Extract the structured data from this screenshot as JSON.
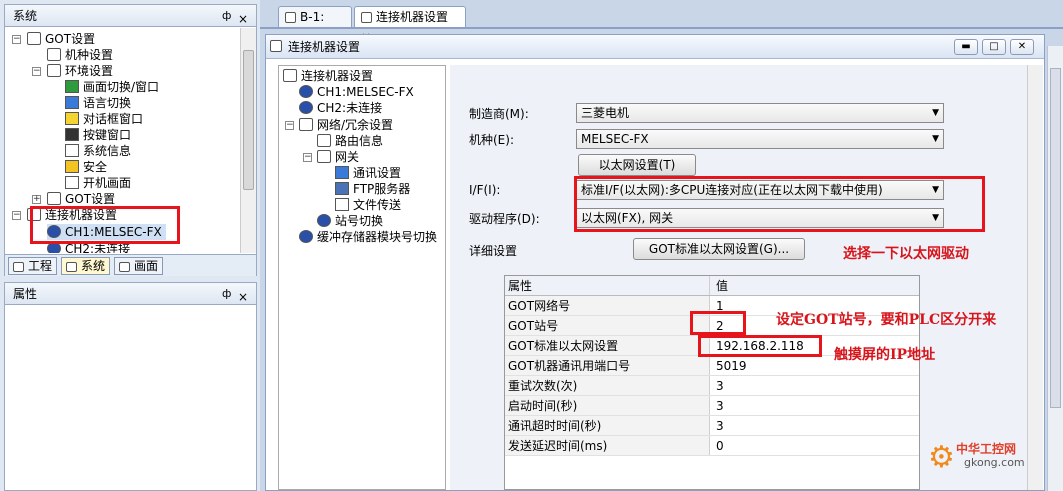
{
  "system_panel": {
    "title": "系统",
    "pin": "ф",
    "close": "×",
    "tree": [
      {
        "label": "GOT设置"
      },
      {
        "label": "机种设置"
      },
      {
        "label": "环境设置"
      },
      {
        "label": "画面切换/窗口"
      },
      {
        "label": "语言切换"
      },
      {
        "label": "对话框窗口"
      },
      {
        "label": "按键窗口"
      },
      {
        "label": "系统信息"
      },
      {
        "label": "安全"
      },
      {
        "label": "开机画面"
      },
      {
        "label": "GOT设置"
      },
      {
        "label": "连接机器设置"
      },
      {
        "label": "CH1:MELSEC-FX"
      },
      {
        "label": "CH2:未连接"
      }
    ],
    "bottom_tabs": [
      "工程",
      "系统",
      "画面"
    ]
  },
  "props_panel": {
    "title": "属性",
    "pin": "ф",
    "close": "×"
  },
  "doc_tabs": [
    {
      "label": "B-1:"
    },
    {
      "label": "连接机器设置",
      "close": "×"
    }
  ],
  "dialog": {
    "title": "连接机器设置",
    "tree": [
      {
        "label": "连接机器设置"
      },
      {
        "label": "CH1:MELSEC-FX"
      },
      {
        "label": "CH2:未连接"
      },
      {
        "label": "网络/冗余设置"
      },
      {
        "label": "路由信息"
      },
      {
        "label": "网关"
      },
      {
        "label": "通讯设置"
      },
      {
        "label": "FTP服务器"
      },
      {
        "label": "文件传送"
      },
      {
        "label": "站号切换"
      },
      {
        "label": "缓冲存储器模块号切换"
      }
    ],
    "maker_label": "制造商(M):",
    "maker_value": "三菱电机",
    "model_label": "机种(E):",
    "model_value": "MELSEC-FX",
    "ethernet_button": "以太网设置(T)",
    "if_label": "I/F(I):",
    "if_value": "标准I/F(以太网):多CPU连接对应(正在以太网下载中使用)",
    "driver_label": "驱动程序(D):",
    "driver_value": "以太网(FX), 网关",
    "detail_label": "详细设置",
    "got_eth_button": "GOT标准以太网设置(G)...",
    "grid_headers": [
      "属性",
      "值"
    ],
    "grid_rows": [
      {
        "name": "GOT网络号",
        "value": "1"
      },
      {
        "name": "GOT站号",
        "value": "2"
      },
      {
        "name": "GOT标准以太网设置",
        "value": "192.168.2.118"
      },
      {
        "name": "GOT机器通讯用端口号",
        "value": "5019"
      },
      {
        "name": "重试次数(次)",
        "value": "3"
      },
      {
        "name": "启动时间(秒)",
        "value": "3"
      },
      {
        "name": "通讯超时时间(秒)",
        "value": "3"
      },
      {
        "name": "发送延迟时间(ms)",
        "value": "0"
      }
    ]
  },
  "annotations": {
    "driver_note": "选择一下以太网驱动",
    "station_note": "设定GOT站号，要和PLC区分开来",
    "ip_note": "触摸屏的IP地址"
  },
  "watermark": {
    "brand": "中华工控网",
    "url": "gkong.com"
  },
  "colors": {
    "annotation_red": "#e8141b",
    "tree_selected": "#cfe0f5"
  }
}
